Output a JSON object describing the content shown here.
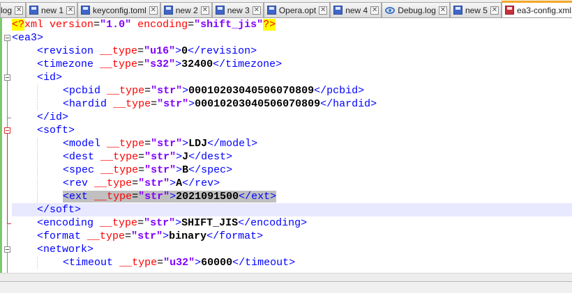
{
  "tabs": [
    {
      "label": "log",
      "icon": "save-doc-icon",
      "active": false
    },
    {
      "label": "new 1",
      "icon": "save-doc-icon",
      "active": false
    },
    {
      "label": "keyconfig.toml",
      "icon": "save-doc-icon",
      "active": false
    },
    {
      "label": "new 2",
      "icon": "save-doc-icon",
      "active": false
    },
    {
      "label": "new 3",
      "icon": "save-doc-icon",
      "active": false
    },
    {
      "label": "Opera.opt",
      "icon": "save-doc-icon",
      "active": false
    },
    {
      "label": "new 4",
      "icon": "save-doc-icon",
      "active": false
    },
    {
      "label": "Debug.log",
      "icon": "eye-icon",
      "active": false
    },
    {
      "label": "new 5",
      "icon": "save-doc-icon",
      "active": false
    },
    {
      "label": "ea3-config.xml",
      "icon": "unsaved-doc-icon",
      "active": true
    }
  ],
  "close_glyph": "✕",
  "editor": {
    "current_line_index": 14,
    "lines": [
      {
        "indent": 0,
        "tokens": [
          [
            "decl",
            "<?"
          ],
          [
            "declname",
            "xml"
          ],
          [
            "eq",
            " "
          ],
          [
            "attr",
            "version"
          ],
          [
            "eq",
            "="
          ],
          [
            "str",
            "\"1.0\""
          ],
          [
            "eq",
            " "
          ],
          [
            "attr",
            "encoding"
          ],
          [
            "eq",
            "="
          ],
          [
            "str",
            "\"shift_jis\""
          ],
          [
            "decl",
            "?>"
          ]
        ]
      },
      {
        "indent": 0,
        "tokens": [
          [
            "tag",
            "<ea3>"
          ]
        ]
      },
      {
        "indent": 1,
        "tokens": [
          [
            "tag",
            "<revision"
          ],
          [
            "eq",
            " "
          ],
          [
            "attr",
            "__type"
          ],
          [
            "eq",
            "="
          ],
          [
            "str",
            "\"u16\""
          ],
          [
            "tag",
            ">"
          ],
          [
            "text",
            "0"
          ],
          [
            "tag",
            "</revision>"
          ]
        ]
      },
      {
        "indent": 1,
        "tokens": [
          [
            "tag",
            "<timezone"
          ],
          [
            "eq",
            " "
          ],
          [
            "attr",
            "__type"
          ],
          [
            "eq",
            "="
          ],
          [
            "str",
            "\"s32\""
          ],
          [
            "tag",
            ">"
          ],
          [
            "text",
            "32400"
          ],
          [
            "tag",
            "</timezone>"
          ]
        ]
      },
      {
        "indent": 1,
        "tokens": [
          [
            "tag",
            "<id>"
          ]
        ]
      },
      {
        "indent": 2,
        "tokens": [
          [
            "tag",
            "<pcbid"
          ],
          [
            "eq",
            " "
          ],
          [
            "attr",
            "__type"
          ],
          [
            "eq",
            "="
          ],
          [
            "str",
            "\"str\""
          ],
          [
            "tag",
            ">"
          ],
          [
            "text",
            "00010203040506070809"
          ],
          [
            "tag",
            "</pcbid>"
          ]
        ]
      },
      {
        "indent": 2,
        "tokens": [
          [
            "tag",
            "<hardid"
          ],
          [
            "eq",
            " "
          ],
          [
            "attr",
            "__type"
          ],
          [
            "eq",
            "="
          ],
          [
            "str",
            "\"str\""
          ],
          [
            "tag",
            ">"
          ],
          [
            "text",
            "00010203040506070809"
          ],
          [
            "tag",
            "</hardid>"
          ]
        ]
      },
      {
        "indent": 1,
        "tokens": [
          [
            "tag",
            "</id>"
          ]
        ]
      },
      {
        "indent": 1,
        "tokens": [
          [
            "tag",
            "<soft>"
          ]
        ]
      },
      {
        "indent": 2,
        "tokens": [
          [
            "tag",
            "<model"
          ],
          [
            "eq",
            " "
          ],
          [
            "attr",
            "__type"
          ],
          [
            "eq",
            "="
          ],
          [
            "str",
            "\"str\""
          ],
          [
            "tag",
            ">"
          ],
          [
            "text",
            "LDJ"
          ],
          [
            "tag",
            "</model>"
          ]
        ]
      },
      {
        "indent": 2,
        "tokens": [
          [
            "tag",
            "<dest"
          ],
          [
            "eq",
            " "
          ],
          [
            "attr",
            "__type"
          ],
          [
            "eq",
            "="
          ],
          [
            "str",
            "\"str\""
          ],
          [
            "tag",
            ">"
          ],
          [
            "text",
            "J"
          ],
          [
            "tag",
            "</dest>"
          ]
        ]
      },
      {
        "indent": 2,
        "tokens": [
          [
            "tag",
            "<spec"
          ],
          [
            "eq",
            " "
          ],
          [
            "attr",
            "__type"
          ],
          [
            "eq",
            "="
          ],
          [
            "str",
            "\"str\""
          ],
          [
            "tag",
            ">"
          ],
          [
            "text",
            "B"
          ],
          [
            "tag",
            "</spec>"
          ]
        ]
      },
      {
        "indent": 2,
        "tokens": [
          [
            "tag",
            "<rev"
          ],
          [
            "eq",
            " "
          ],
          [
            "attr",
            "__type"
          ],
          [
            "eq",
            "="
          ],
          [
            "str",
            "\"str\""
          ],
          [
            "tag",
            ">"
          ],
          [
            "text",
            "A"
          ],
          [
            "tag",
            "</rev>"
          ]
        ]
      },
      {
        "indent": 2,
        "selected": true,
        "tokens": [
          [
            "tag",
            "<ext"
          ],
          [
            "eq",
            " "
          ],
          [
            "attr",
            "__type"
          ],
          [
            "eq",
            "="
          ],
          [
            "str",
            "\"str\""
          ],
          [
            "tag",
            ">"
          ],
          [
            "text",
            "2021091500"
          ],
          [
            "tag",
            "</ext>"
          ]
        ]
      },
      {
        "indent": 1,
        "tokens": [
          [
            "tag",
            "</soft>"
          ]
        ]
      },
      {
        "indent": 1,
        "tokens": [
          [
            "tag",
            "<encoding"
          ],
          [
            "eq",
            " "
          ],
          [
            "attr",
            "__type"
          ],
          [
            "eq",
            "="
          ],
          [
            "str",
            "\"str\""
          ],
          [
            "tag",
            ">"
          ],
          [
            "text",
            "SHIFT_JIS"
          ],
          [
            "tag",
            "</encoding>"
          ]
        ]
      },
      {
        "indent": 1,
        "tokens": [
          [
            "tag",
            "<format"
          ],
          [
            "eq",
            " "
          ],
          [
            "attr",
            "__type"
          ],
          [
            "eq",
            "="
          ],
          [
            "str",
            "\"str\""
          ],
          [
            "tag",
            ">"
          ],
          [
            "text",
            "binary"
          ],
          [
            "tag",
            "</format>"
          ]
        ]
      },
      {
        "indent": 1,
        "tokens": [
          [
            "tag",
            "<network>"
          ]
        ]
      },
      {
        "indent": 2,
        "tokens": [
          [
            "tag",
            "<timeout"
          ],
          [
            "eq",
            " "
          ],
          [
            "attr",
            "__type"
          ],
          [
            "eq",
            "="
          ],
          [
            "str",
            "\"u32\""
          ],
          [
            "tag",
            ">"
          ],
          [
            "text",
            "60000"
          ],
          [
            "tag",
            "</timeout>"
          ]
        ]
      }
    ]
  },
  "colors": {
    "tag": "#0000ff",
    "attr": "#ff0000",
    "string": "#8000ff",
    "text": "#000000",
    "current_line": "#e8e8ff",
    "selection": "#c0c0c0",
    "active_tab_accent": "#f5a623",
    "change_margin": "#7cc96d"
  }
}
